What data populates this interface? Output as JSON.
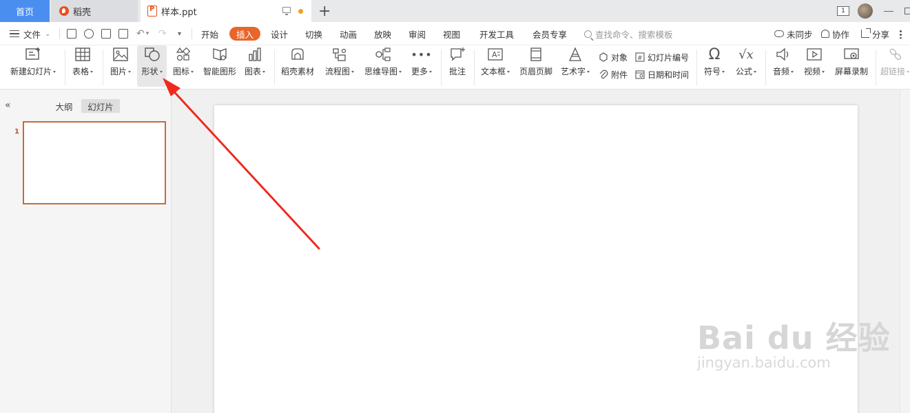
{
  "tabs": {
    "home": "首页",
    "daoke": "稻壳",
    "doc": "样本.ppt",
    "add": "+"
  },
  "window": {
    "badge": "1"
  },
  "menubar": {
    "file": "文件",
    "tabs": [
      "开始",
      "插入",
      "设计",
      "切换",
      "动画",
      "放映",
      "审阅",
      "视图",
      "开发工具",
      "会员专享"
    ],
    "active_tab": "插入",
    "search_placeholder": "查找命令、搜索模板",
    "sync": "未同步",
    "collab": "协作",
    "share": "分享"
  },
  "ribbon": {
    "new_slide": "新建幻灯片",
    "table": "表格",
    "picture": "图片",
    "shape": "形状",
    "icon": "图标",
    "smart_art": "智能图形",
    "chart": "图表",
    "daoke_material": "稻壳素材",
    "flowchart": "流程图",
    "mindmap": "思维导图",
    "more": "更多",
    "comment": "批注",
    "textbox": "文本框",
    "header_footer": "页眉页脚",
    "wordart": "艺术字",
    "object": "对象",
    "attachment": "附件",
    "slide_number": "幻灯片编号",
    "datetime": "日期和时间",
    "symbol": "符号",
    "formula": "公式",
    "audio": "音频",
    "video": "视频",
    "screen_record": "屏幕录制",
    "hyperlink": "超链接"
  },
  "leftpane": {
    "outline": "大纲",
    "slides": "幻灯片",
    "slide_number": "1"
  },
  "watermark": {
    "main": "Bai du 经验",
    "sub": "jingyan.baidu.com"
  },
  "colors": {
    "accent": "#e8652b",
    "home_tab": "#4a8ff0",
    "annotation_arrow": "#f02a1e"
  }
}
